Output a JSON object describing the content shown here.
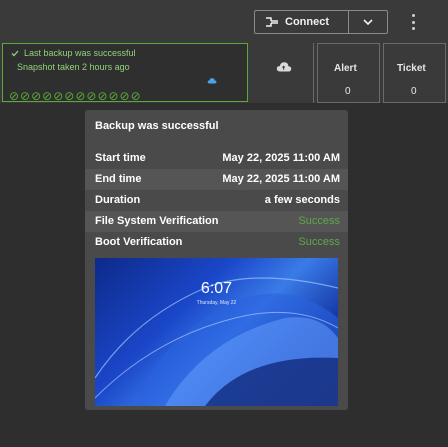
{
  "toolbar": {
    "connect_label": "Connect"
  },
  "banner": {
    "line1": "Last backup was successful",
    "line2": "Snapshot taken 2 hours ago",
    "history_dots": "⊘⊘⊘⊘⊘⊘⊘⊘⊘⊘⊘⊘",
    "status_color": "#5aaa3a"
  },
  "grid": {
    "alert_label": "Alert",
    "ticket_label": "Ticket",
    "alert_count": "0",
    "ticket_count": "0"
  },
  "popup": {
    "title": "Backup was successful",
    "rows": [
      {
        "key": "Start time",
        "value": "May 22, 2025 11:00 AM"
      },
      {
        "key": "End time",
        "value": "May 22, 2025 11:00 AM"
      },
      {
        "key": "Duration",
        "value": "a few seconds"
      },
      {
        "key": "File System Verification",
        "value": "Success"
      },
      {
        "key": "Boot Verification",
        "value": "Success"
      }
    ],
    "screenshot_clock": "6:07",
    "screenshot_date": "Thursday, May 22",
    "success_color": "#5fa84a"
  }
}
